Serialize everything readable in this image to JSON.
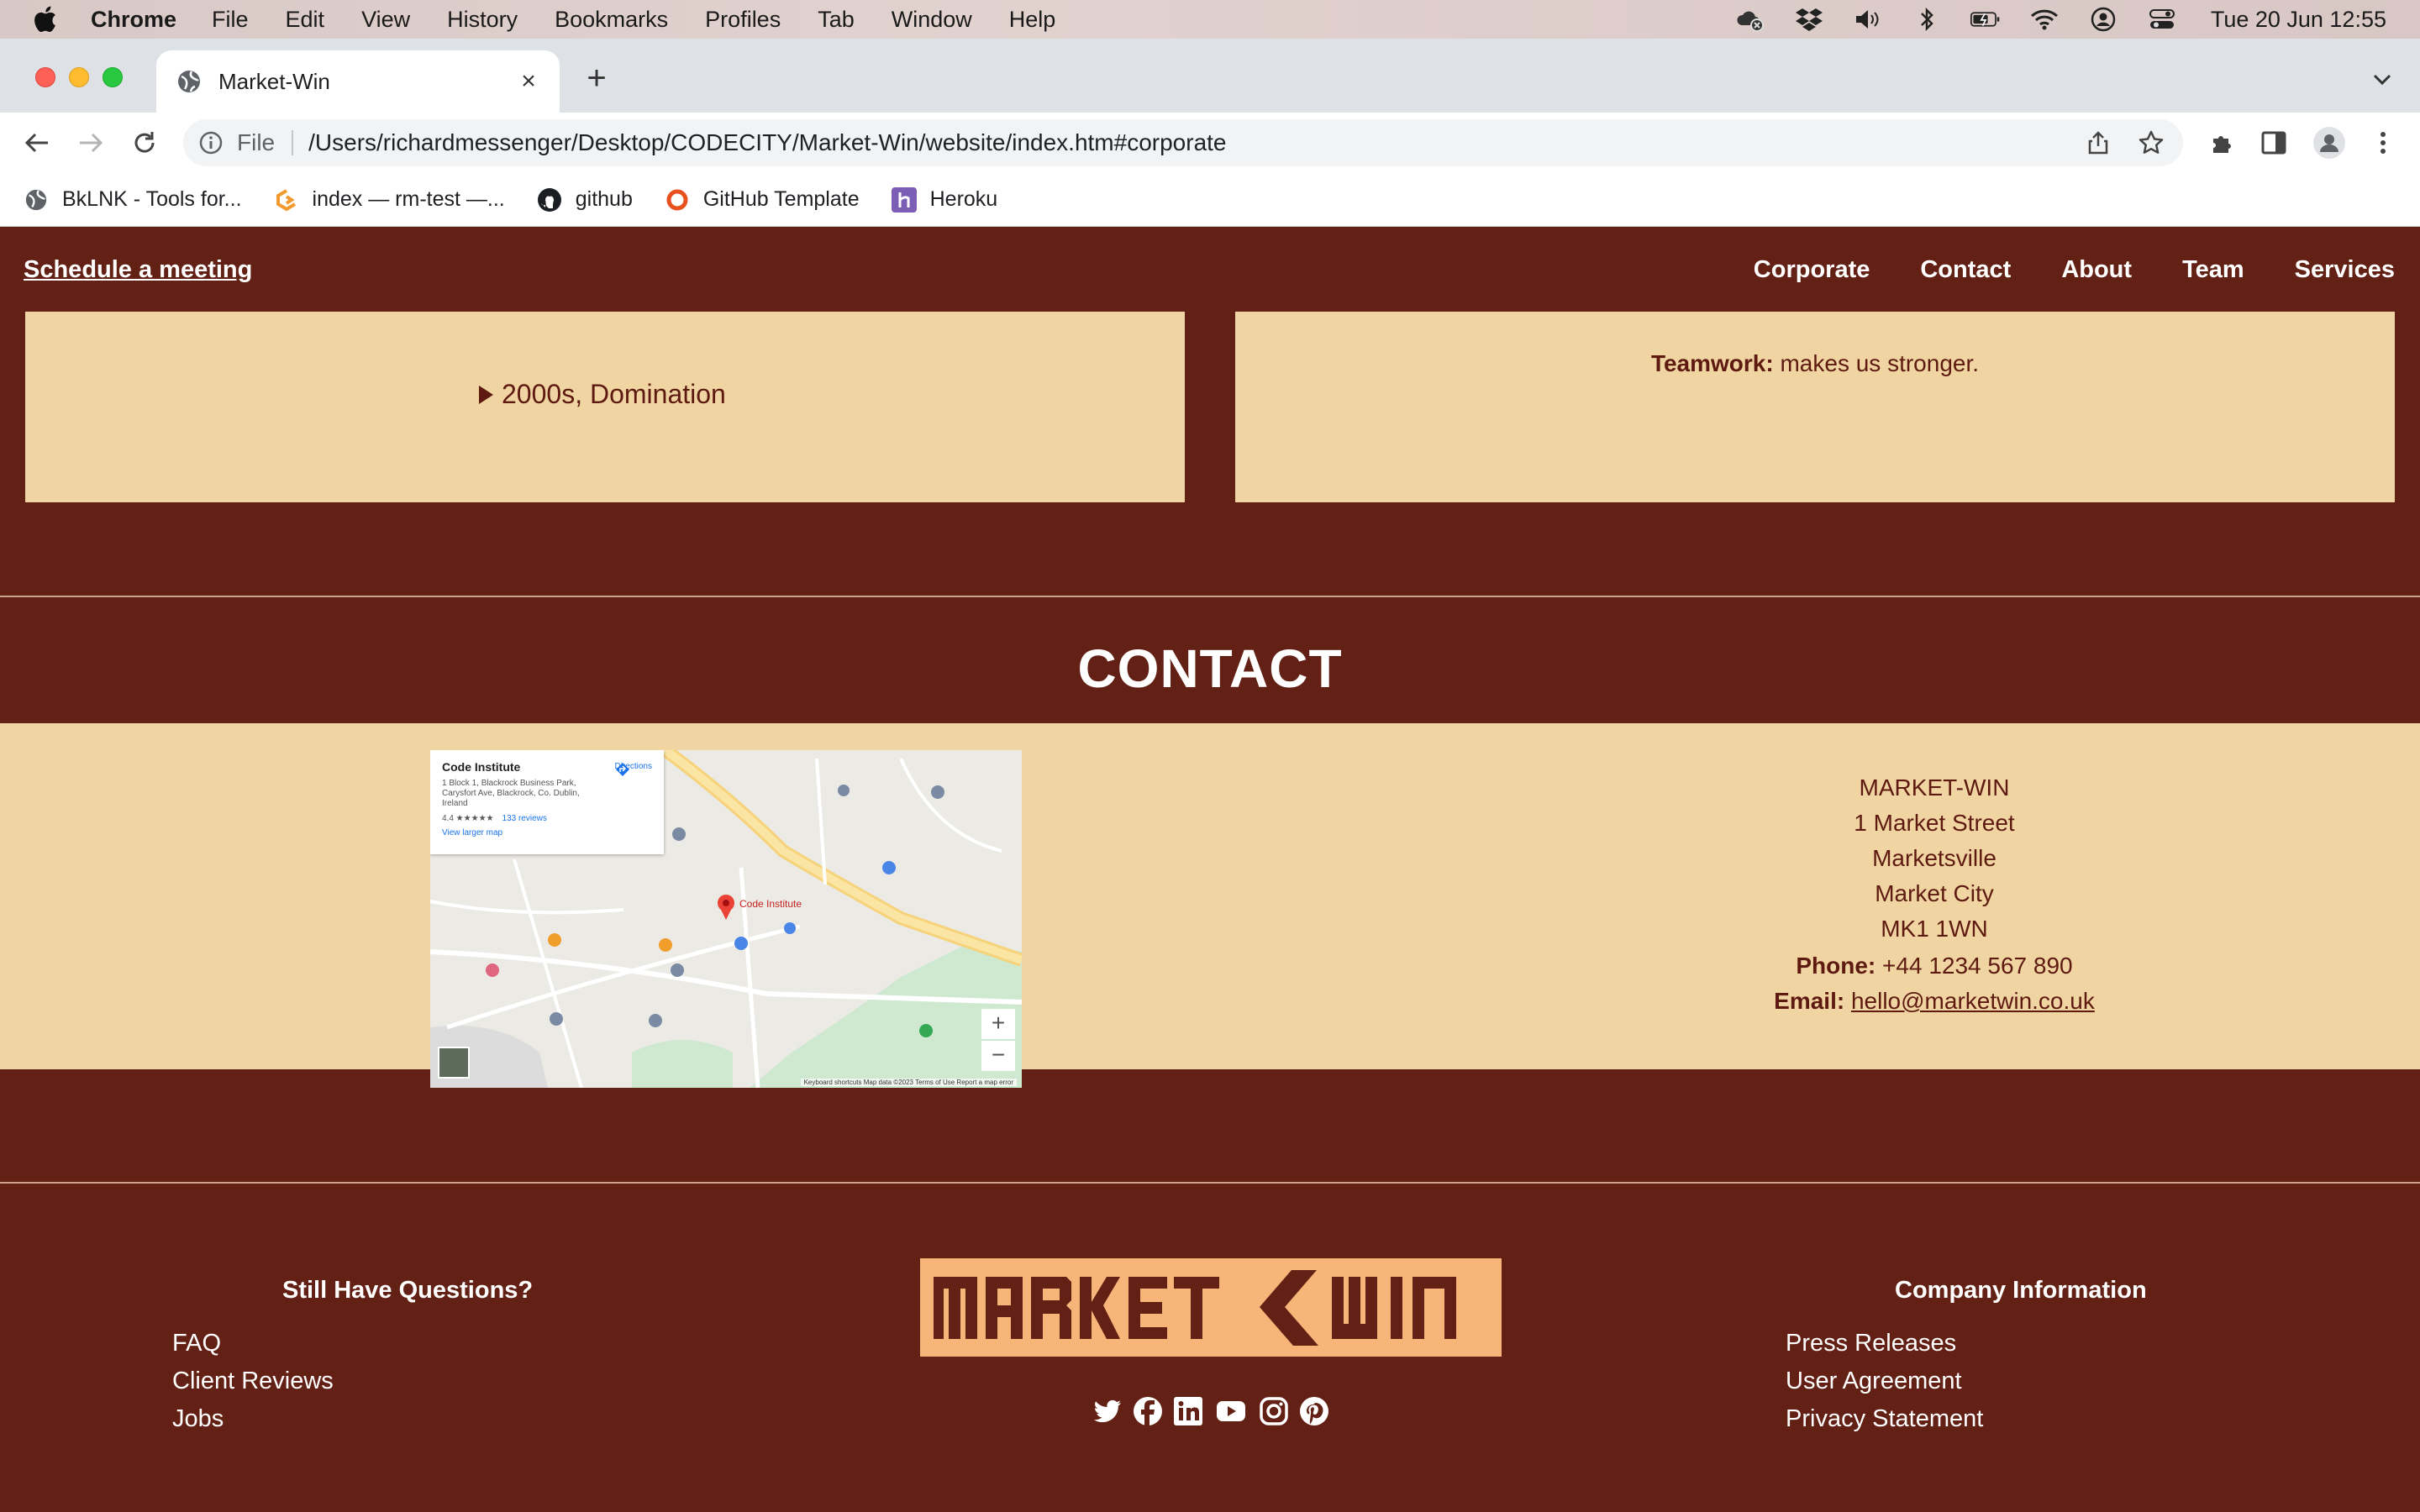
{
  "menubar": {
    "app_name": "Chrome",
    "items": [
      "File",
      "Edit",
      "View",
      "History",
      "Bookmarks",
      "Profiles",
      "Tab",
      "Window",
      "Help"
    ],
    "clock": "Tue 20 Jun  12:55"
  },
  "browser": {
    "tab_title": "Market-Win",
    "omnibox_scheme_label": "File",
    "url": "/Users/richardmessenger/Desktop/CODECITY/Market-Win/website/index.htm#corporate",
    "bookmarks": [
      {
        "label": "BkLNK - Tools for...",
        "icon": "globe-icon"
      },
      {
        "label": "index — rm-test —...",
        "icon": "figma-icon"
      },
      {
        "label": "github",
        "icon": "github-icon"
      },
      {
        "label": "GitHub Template",
        "icon": "ring-icon"
      },
      {
        "label": "Heroku",
        "icon": "heroku-icon"
      }
    ]
  },
  "site": {
    "nav": {
      "schedule": "Schedule a meeting",
      "links": [
        "Corporate",
        "Contact",
        "About",
        "Team",
        "Services"
      ]
    },
    "history_summary": "2000s, Domination",
    "values": {
      "teamwork_label": "Teamwork:",
      "teamwork_text": " makes us stronger."
    },
    "contact": {
      "heading": "CONTACT",
      "map": {
        "place": "Code Institute",
        "address": "1 Block 1, Blackrock Business Park, Carysfort Ave, Blackrock, Co. Dublin, Ireland",
        "rating": "4.4 ★★★★★",
        "reviews": "133 reviews",
        "larger_map": "View larger map",
        "directions": "Directions",
        "attribution": "Keyboard shortcuts   Map data ©2023   Terms of Use   Report a map error"
      },
      "address_lines": [
        "MARKET-WIN",
        "1 Market Street",
        "Marketsville",
        "Market City",
        "MK1 1WN"
      ],
      "phone_label": "Phone:",
      "phone": " +44 1234 567 890",
      "email_label": "Email:",
      "email": "hello@marketwin.co.uk"
    },
    "footer": {
      "left_title": "Still Have Questions?",
      "left_links": [
        "FAQ",
        "Client Reviews",
        "Jobs"
      ],
      "right_title": "Company Information",
      "right_links": [
        "Press Releases",
        "User Agreement",
        "Privacy Statement"
      ],
      "logo_text": "MARKET WIN",
      "socials": [
        "twitter-icon",
        "facebook-icon",
        "linkedin-icon",
        "youtube-icon",
        "instagram-icon",
        "pinterest-icon"
      ]
    }
  },
  "colors": {
    "brand_maroon": "#632014",
    "panel_tan": "#f0d5a3",
    "text_brown": "#5e1a10",
    "logo_orange": "#f7b57a"
  }
}
